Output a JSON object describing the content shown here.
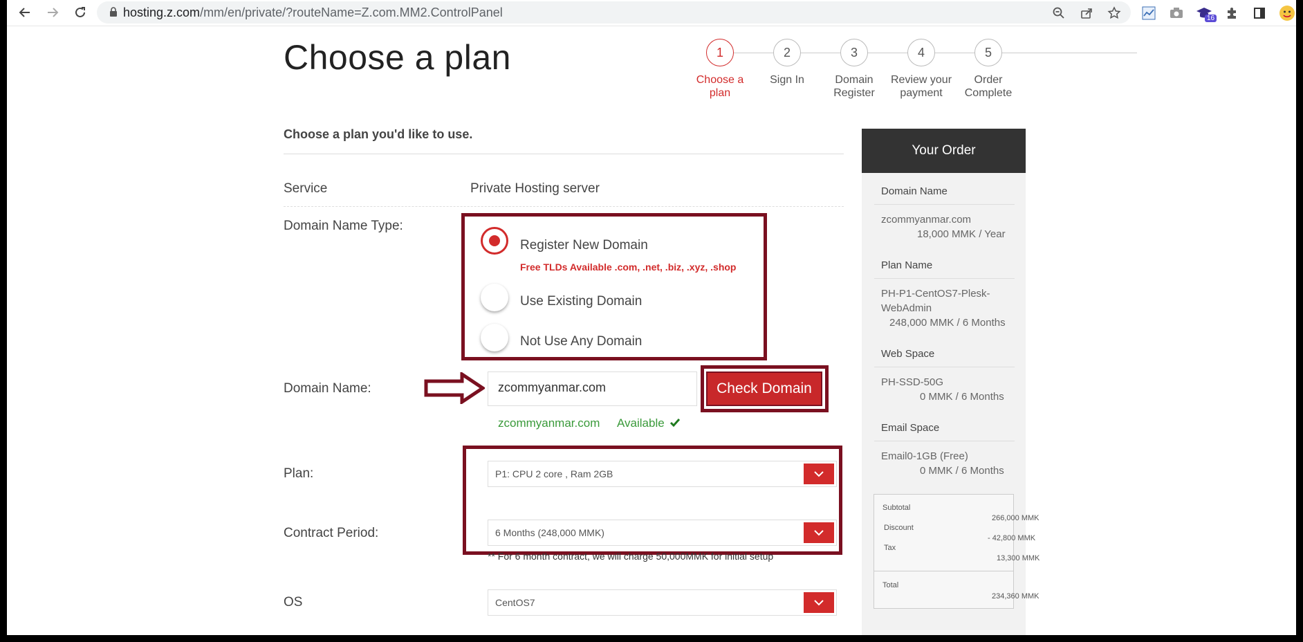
{
  "browser": {
    "url_host": "hosting.z.com",
    "url_path": "/mm/en/private/?routeName=Z.com.MM2.ControlPanel",
    "extension_badge": "16"
  },
  "page": {
    "title": "Choose a plan",
    "subtitle": "Choose a plan you'd like to use."
  },
  "steps": [
    {
      "num": "1",
      "label": "Choose a plan",
      "active": true
    },
    {
      "num": "2",
      "label": "Sign In"
    },
    {
      "num": "3",
      "label": "Domain Register"
    },
    {
      "num": "4",
      "label": "Review your payment"
    },
    {
      "num": "5",
      "label": "Order Complete"
    }
  ],
  "form": {
    "service_label": "Service",
    "service_value": "Private Hosting server",
    "domain_type_label": "Domain Name Type:",
    "options": [
      {
        "label": "Register New Domain",
        "checked": true
      },
      {
        "label": "Use Existing Domain",
        "checked": false
      },
      {
        "label": "Not Use Any Domain",
        "checked": false
      }
    ],
    "tld_note": "Free TLDs Available .com, .net, .biz, .xyz, .shop",
    "domain_name_label": "Domain Name:",
    "domain_name_value": "zcommyanmar.com",
    "check_button": "Check Domain",
    "availability_domain": "zcommyanmar.com",
    "availability_status": "Available",
    "plan_label": "Plan:",
    "plan_value": "P1: CPU 2 core , Ram 2GB",
    "contract_label": "Contract Period:",
    "contract_value": "6 Months (248,000 MMK)",
    "contract_note": "** For 6 month contract, we will charge 50,000MMK for initial setup",
    "os_label": "OS",
    "os_value": "CentOS7"
  },
  "order": {
    "title": "Your Order",
    "domain_name_h": "Domain Name",
    "domain_name": "zcommyanmar.com",
    "domain_price": "18,000 MMK / Year",
    "plan_name_h": "Plan Name",
    "plan_name": "PH-P1-CentOS7-Plesk-WebAdmin",
    "plan_price": "248,000 MMK / 6 Months",
    "web_space_h": "Web Space",
    "web_space": "PH-SSD-50G",
    "web_space_price": "0 MMK / 6 Months",
    "email_space_h": "Email Space",
    "email_space": "Email0-1GB (Free)",
    "email_space_price": "0 MMK / 6 Months",
    "subtotal_label": "Subtotal",
    "subtotal": "266,000 MMK",
    "discount_label": "Discount",
    "discount": "- 42,800 MMK",
    "tax_label": "Tax",
    "tax": "13,300 MMK",
    "total_label": "Total",
    "total": "234,360 MMK"
  },
  "colors": {
    "accent": "#d22b2b",
    "annotation": "#7a1020",
    "available": "#3a9a3a"
  }
}
